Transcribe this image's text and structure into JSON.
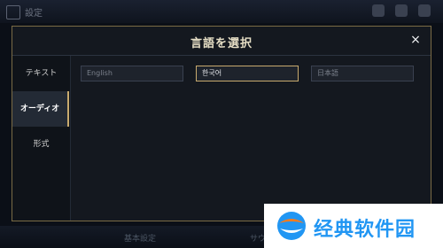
{
  "background": {
    "app_title": "設定",
    "bottom_tab_1": "基本設定",
    "bottom_tab_2": "サウンド"
  },
  "dialog": {
    "title": "言語を選択",
    "close_label": "×",
    "sidebar": [
      {
        "label": "テキスト",
        "active": false
      },
      {
        "label": "オーディオ",
        "active": true
      },
      {
        "label": "形式",
        "active": false
      }
    ],
    "languages": [
      {
        "label": "English",
        "selected": false
      },
      {
        "label": "한국어",
        "selected": true
      },
      {
        "label": "日本語",
        "selected": false
      }
    ]
  },
  "watermark": {
    "text": "经典软件园"
  },
  "colors": {
    "accent_gold": "#c8aa6e",
    "dialog_bg": "#14181f",
    "watermark_blue": "#2196f3",
    "watermark_orange": "#f47c20"
  }
}
